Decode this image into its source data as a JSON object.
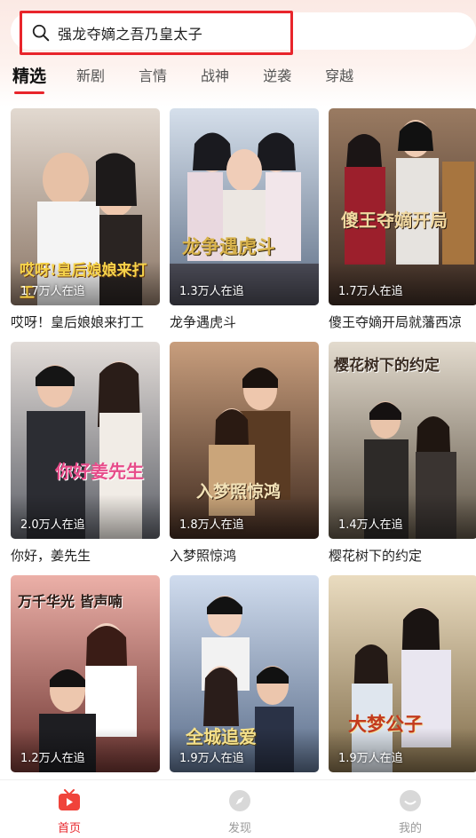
{
  "search": {
    "query": "强龙夺嫡之吾乃皇太子"
  },
  "tabs": [
    {
      "label": "精选",
      "active": true
    },
    {
      "label": "新剧"
    },
    {
      "label": "言情"
    },
    {
      "label": "战神"
    },
    {
      "label": "逆袭"
    },
    {
      "label": "穿越"
    }
  ],
  "dramas": [
    {
      "title": "哎呀！皇后娘娘来打工",
      "followers": "1.7万人在追",
      "poster_text": "哎呀!皇后娘娘来打工",
      "colors": [
        "#d9cfc6",
        "#7a6a5e"
      ]
    },
    {
      "title": "龙争遇虎斗",
      "followers": "1.3万人在追",
      "poster_text": "龙争遇虎斗",
      "colors": [
        "#cfd8e6",
        "#6e7d94"
      ]
    },
    {
      "title": "傻王夺嫡开局就藩西凉",
      "followers": "1.7万人在追",
      "poster_text": "傻王夺嫡开局",
      "colors": [
        "#8c6a52",
        "#3b2a22"
      ]
    },
    {
      "title": "你好，姜先生",
      "followers": "2.0万人在追",
      "poster_text": "你好姜先生",
      "colors": [
        "#d9d2cf",
        "#5b5d66"
      ]
    },
    {
      "title": "入梦照惊鸿",
      "followers": "1.8万人在追",
      "poster_text": "入梦照惊鸿",
      "colors": [
        "#c79a78",
        "#4a3326"
      ]
    },
    {
      "title": "樱花树下的约定",
      "followers": "1.4万人在追",
      "poster_text": "樱花树下的约定",
      "colors": [
        "#dcd3c4",
        "#5e5446"
      ]
    },
    {
      "title": "",
      "followers": "1.2万人在追",
      "poster_text": "万千华光 皆声喃",
      "colors": [
        "#e9a7a0",
        "#7a3b38"
      ]
    },
    {
      "title": "",
      "followers": "1.9万人在追",
      "poster_text": "全城追爱",
      "colors": [
        "#c9d6ea",
        "#5c6f8c"
      ]
    },
    {
      "title": "",
      "followers": "1.9万人在追",
      "poster_text": "大梦公子",
      "colors": [
        "#e6d6b6",
        "#7d6a49"
      ]
    }
  ],
  "nav": [
    {
      "label": "首页",
      "icon": "tv-icon",
      "active": true
    },
    {
      "label": "发现",
      "icon": "compass-icon"
    },
    {
      "label": "我的",
      "icon": "user-icon"
    }
  ],
  "theme": {
    "accent": "#e8252b"
  }
}
